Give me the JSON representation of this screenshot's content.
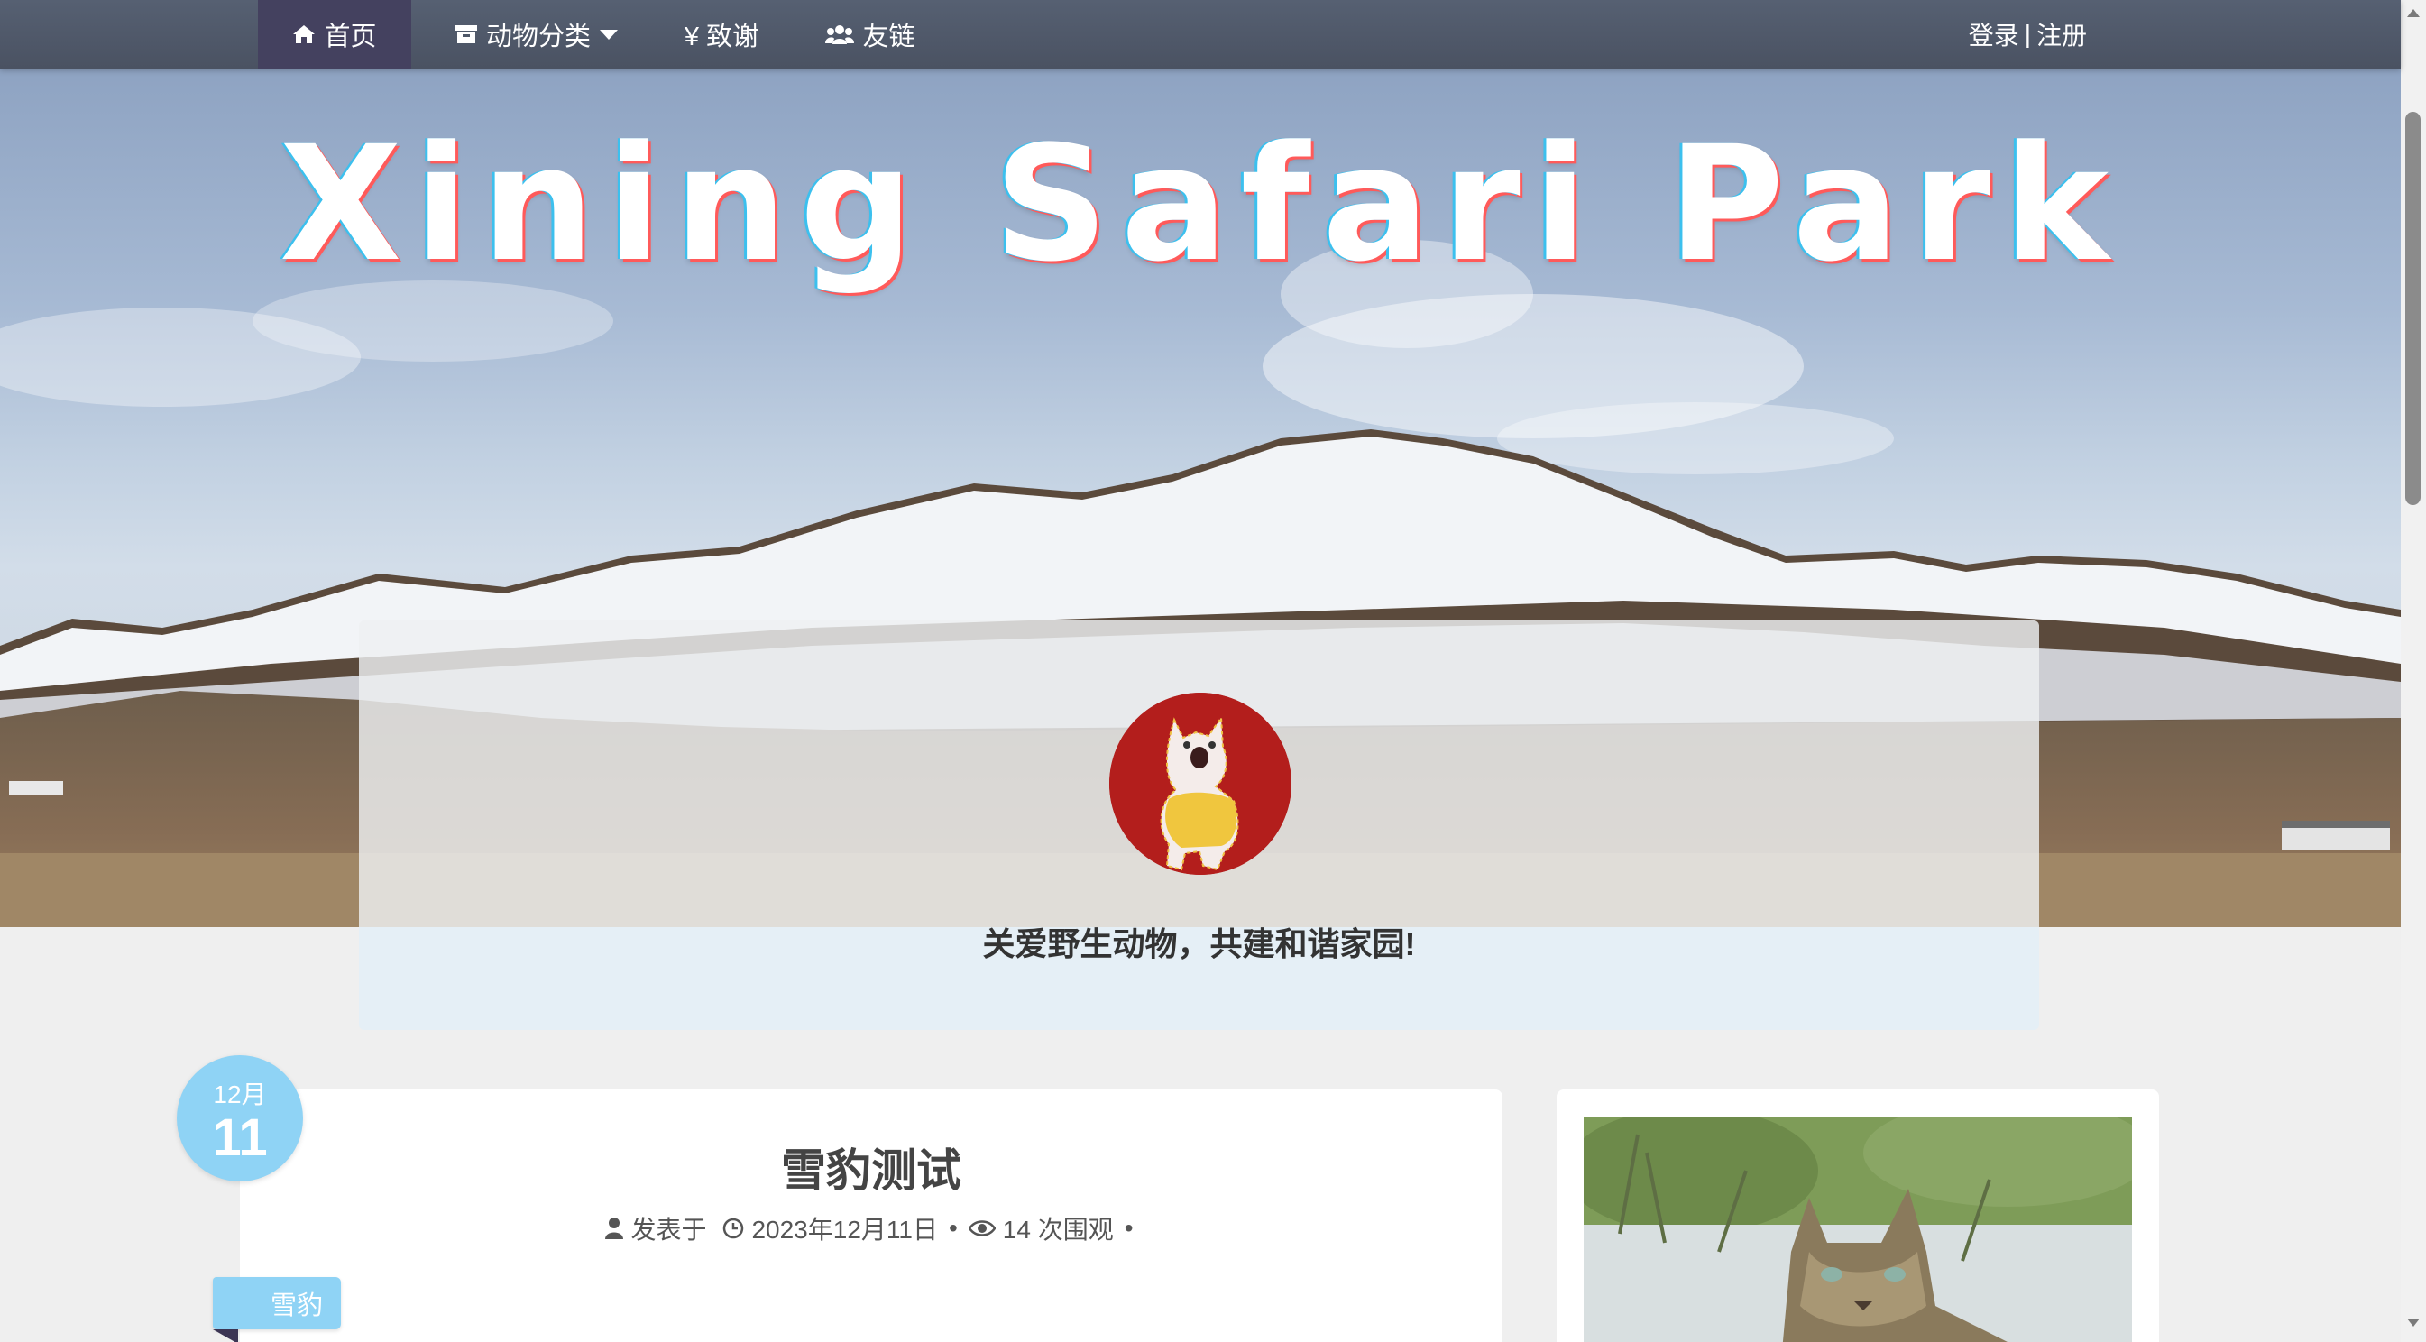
{
  "nav": {
    "items": [
      {
        "label": "首页",
        "icon": "home-icon",
        "active": true
      },
      {
        "label": "动物分类",
        "icon": "archive-icon",
        "has_dropdown": true
      },
      {
        "label": "¥ 致谢",
        "icon": "yen-icon"
      },
      {
        "label": "友链",
        "icon": "users-icon"
      }
    ],
    "login": "登录",
    "separator": "|",
    "register": "注册"
  },
  "hero": {
    "title": "Xining Safari Park"
  },
  "profile": {
    "motto": "关爱野生动物，共建和谐家园!"
  },
  "post": {
    "title": "雪豹测试",
    "posted_prefix": "发表于",
    "date": "2023年12月11日",
    "views": "14 次围观",
    "bullet": "•",
    "date_badge": {
      "month": "12月",
      "day": "11"
    },
    "tag": "雪豹"
  },
  "colors": {
    "nav_bg": "#4f5868",
    "nav_active": "#44415f",
    "accent": "#8fd3f5",
    "avatar_bg": "#b31e1c",
    "page_bg": "#efefef"
  }
}
